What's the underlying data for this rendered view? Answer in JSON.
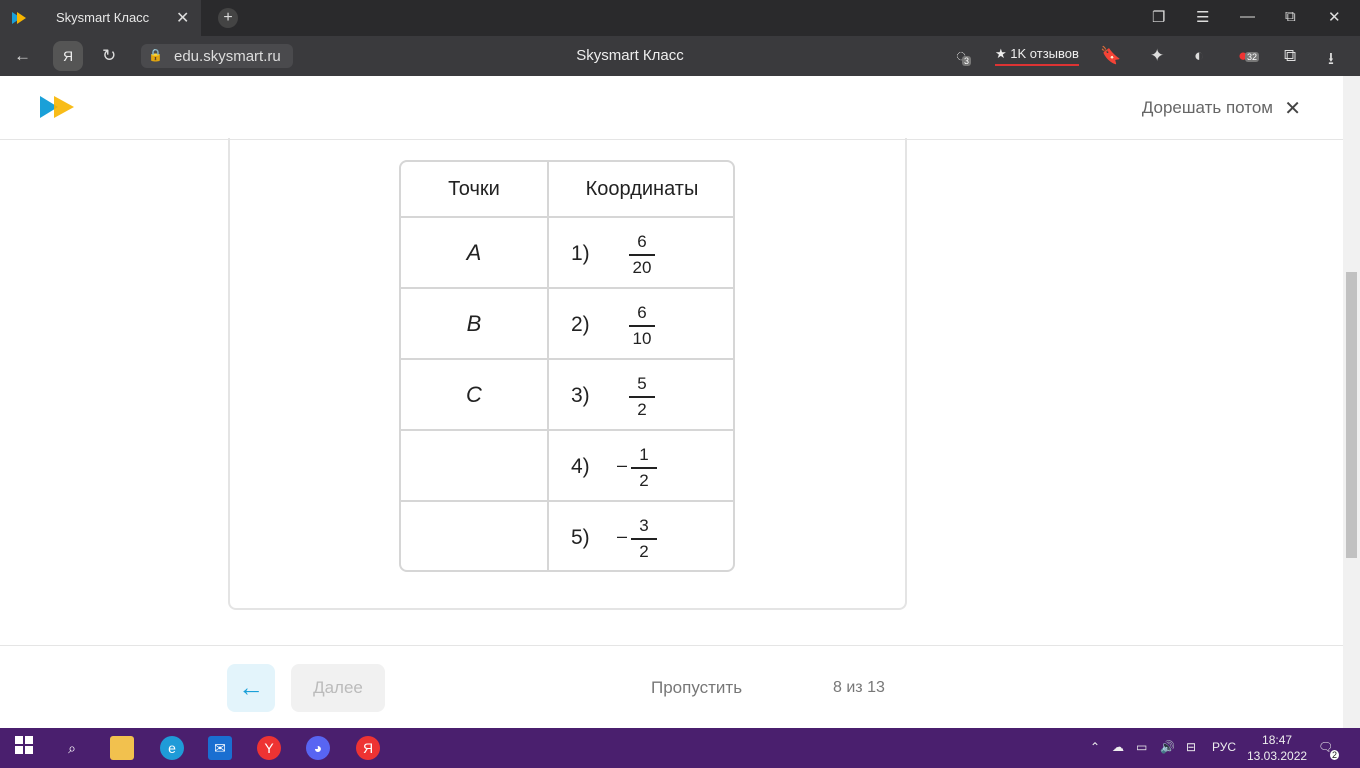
{
  "browser": {
    "tab_title": "Skysmart Класс",
    "url": "edu.skysmart.ru",
    "page_title": "Skysmart Класс",
    "reviews_label": "1K отзывов",
    "tab_badge": "3",
    "extension_badge": "32"
  },
  "header": {
    "later_label": "Дорешать потом"
  },
  "matching_table": {
    "left_header": "Точки",
    "right_header": "Координаты",
    "rows": [
      {
        "point": "A",
        "index": "1)",
        "sign": "",
        "num": "6",
        "den": "20"
      },
      {
        "point": "B",
        "index": "2)",
        "sign": "",
        "num": "6",
        "den": "10"
      },
      {
        "point": "C",
        "index": "3)",
        "sign": "",
        "num": "5",
        "den": "2"
      },
      {
        "point": "",
        "index": "4)",
        "sign": "–",
        "num": "1",
        "den": "2"
      },
      {
        "point": "",
        "index": "5)",
        "sign": "–",
        "num": "3",
        "den": "2"
      }
    ]
  },
  "footer": {
    "next_label": "Далее",
    "skip_label": "Пропустить",
    "progress": "8 из 13"
  },
  "taskbar": {
    "language": "РУС",
    "time": "18:47",
    "date": "13.03.2022",
    "notifications": "2"
  }
}
